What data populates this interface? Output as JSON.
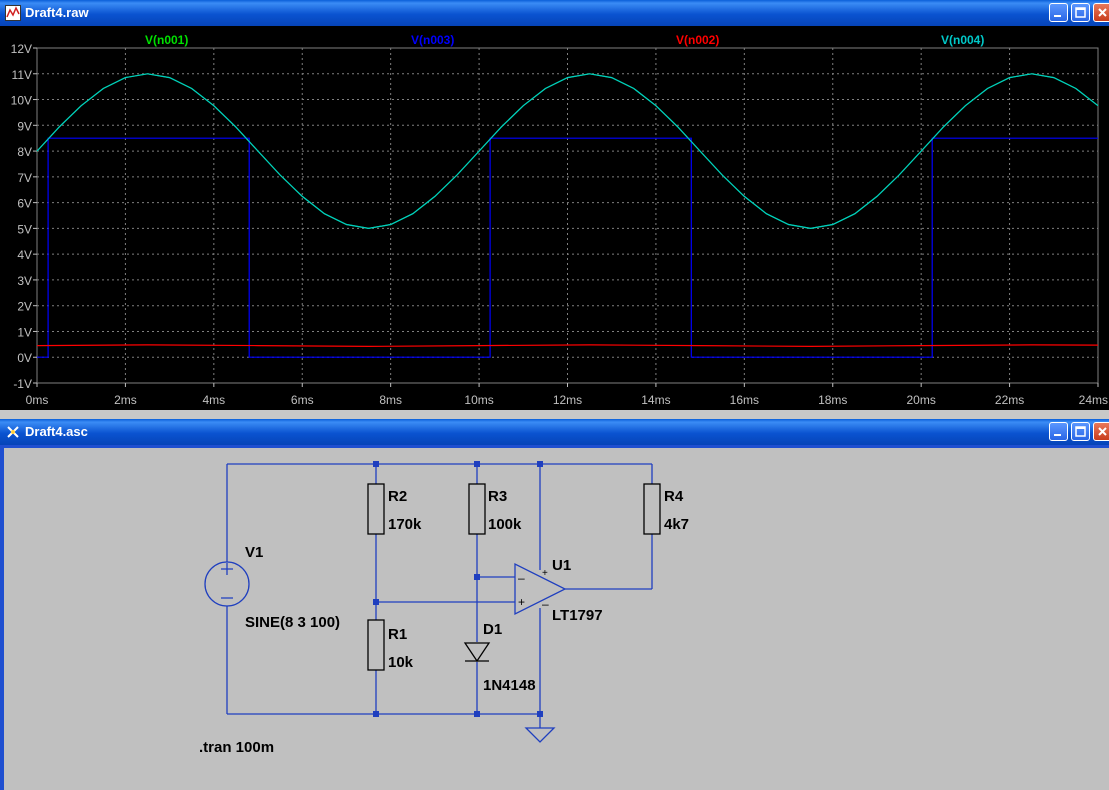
{
  "waveform_window": {
    "title": "Draft4.raw",
    "y_tick_labels": [
      "12V",
      "11V",
      "10V",
      "9V",
      "8V",
      "7V",
      "6V",
      "5V",
      "4V",
      "3V",
      "2V",
      "1V",
      "0V",
      "-1V"
    ],
    "x_tick_labels": [
      "0ms",
      "2ms",
      "4ms",
      "6ms",
      "8ms",
      "10ms",
      "12ms",
      "14ms",
      "16ms",
      "18ms",
      "20ms",
      "22ms",
      "24ms"
    ],
    "colors": {
      "background": "#000000",
      "grid": "#7f7f7f",
      "axis_text": "#c0c0c0"
    }
  },
  "chart_data": {
    "type": "line",
    "xlabel": "",
    "ylabel": "",
    "xlim": [
      0,
      24
    ],
    "ylim": [
      -1,
      12
    ],
    "x_unit": "ms",
    "y_unit": "V",
    "grid": true,
    "legend": "top",
    "series": [
      {
        "name": "V(n001)",
        "color": "#00e000",
        "x": [
          0,
          0.5,
          1,
          1.5,
          2,
          2.5,
          3,
          3.5,
          4,
          4.5,
          5,
          5.5,
          6,
          6.5,
          7,
          7.5,
          8,
          8.5,
          9,
          9.5,
          10,
          10.5,
          11,
          11.5,
          12,
          12.5,
          13,
          13.5,
          14,
          14.5,
          15,
          15.5,
          16,
          16.5,
          17,
          17.5,
          18,
          18.5,
          19,
          19.5,
          20,
          20.5,
          21,
          21.5,
          22,
          22.5,
          23,
          23.5,
          24
        ],
        "values": [
          8,
          8.93,
          9.76,
          10.43,
          10.85,
          11,
          10.85,
          10.43,
          9.76,
          8.93,
          8,
          7.07,
          6.24,
          5.57,
          5.15,
          5,
          5.15,
          5.57,
          6.24,
          7.07,
          8,
          8.93,
          9.76,
          10.43,
          10.85,
          11,
          10.85,
          10.43,
          9.76,
          8.93,
          8,
          7.07,
          6.24,
          5.57,
          5.15,
          5,
          5.15,
          5.57,
          6.24,
          7.07,
          8,
          8.93,
          9.76,
          10.43,
          10.85,
          11,
          10.85,
          10.43,
          9.76
        ]
      },
      {
        "name": "V(n003)",
        "color": "#0000ff",
        "x": [
          0,
          0.25,
          0.25,
          4.8,
          4.8,
          10.25,
          10.25,
          14.8,
          14.8,
          20.25,
          20.25,
          24
        ],
        "values": [
          0,
          0,
          8.5,
          8.5,
          0,
          0,
          8.5,
          8.5,
          0,
          0,
          8.5,
          8.5
        ]
      },
      {
        "name": "V(n002)",
        "color": "#ff0000",
        "x": [
          0,
          2.5,
          5,
          7.5,
          10,
          12.5,
          15,
          17.5,
          20,
          22.5,
          24
        ],
        "values": [
          0.45,
          0.48,
          0.45,
          0.42,
          0.45,
          0.48,
          0.45,
          0.42,
          0.45,
          0.48,
          0.47
        ]
      },
      {
        "name": "V(n004)",
        "color": "#00c8c8",
        "x": [
          0,
          0.5,
          1,
          1.5,
          2,
          2.5,
          3,
          3.5,
          4,
          4.5,
          5,
          5.5,
          6,
          6.5,
          7,
          7.5,
          8,
          8.5,
          9,
          9.5,
          10,
          10.5,
          11,
          11.5,
          12,
          12.5,
          13,
          13.5,
          14,
          14.5,
          15,
          15.5,
          16,
          16.5,
          17,
          17.5,
          18,
          18.5,
          19,
          19.5,
          20,
          20.5,
          21,
          21.5,
          22,
          22.5,
          23,
          23.5,
          24
        ],
        "values": [
          8,
          8.93,
          9.76,
          10.43,
          10.85,
          11,
          10.85,
          10.43,
          9.76,
          8.93,
          8,
          7.07,
          6.24,
          5.57,
          5.15,
          5,
          5.15,
          5.57,
          6.24,
          7.07,
          8,
          8.93,
          9.76,
          10.43,
          10.85,
          11,
          10.85,
          10.43,
          9.76,
          8.93,
          8,
          7.07,
          6.24,
          5.57,
          5.15,
          5,
          5.15,
          5.57,
          6.24,
          7.07,
          8,
          8.93,
          9.76,
          10.43,
          10.85,
          11,
          10.85,
          10.43,
          9.76
        ]
      }
    ]
  },
  "schematic_window": {
    "title": "Draft4.asc",
    "wire_color": "#1f3fbf",
    "components": {
      "v1": {
        "name": "V1",
        "value": "SINE(8 3 100)"
      },
      "r1": {
        "name": "R1",
        "value": "10k"
      },
      "r2": {
        "name": "R2",
        "value": "170k"
      },
      "r3": {
        "name": "R3",
        "value": "100k"
      },
      "r4": {
        "name": "R4",
        "value": "4k7"
      },
      "d1": {
        "name": "D1",
        "value": "1N4148"
      },
      "u1": {
        "name": "U1",
        "value": "LT1797"
      }
    },
    "directive": ".tran 100m"
  }
}
